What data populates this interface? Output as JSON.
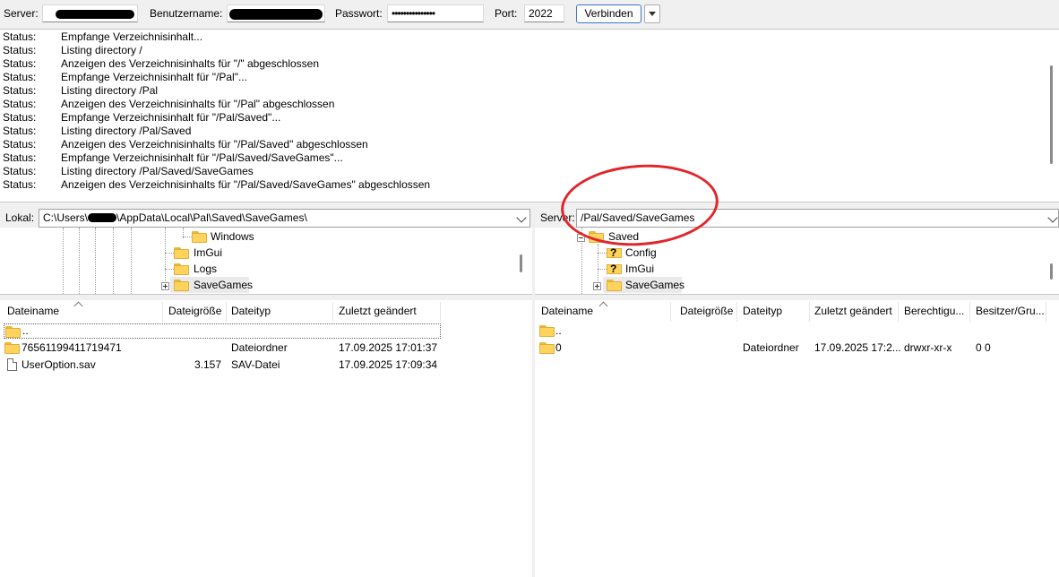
{
  "quickconnect": {
    "server_label": "Server:",
    "server_value": "",
    "username_label": "Benutzername:",
    "username_value": "",
    "password_label": "Passwort:",
    "password_value": "•••••••••••••••",
    "port_label": "Port:",
    "port_value": "2022",
    "connect_label": "Verbinden"
  },
  "log": [
    {
      "k": "Status:",
      "v": "Empfange Verzeichnisinhalt..."
    },
    {
      "k": "Status:",
      "v": "Listing directory /"
    },
    {
      "k": "Status:",
      "v": "Anzeigen des Verzeichnisinhalts für \"/\" abgeschlossen"
    },
    {
      "k": "Status:",
      "v": "Empfange Verzeichnisinhalt für \"/Pal\"..."
    },
    {
      "k": "Status:",
      "v": "Listing directory /Pal"
    },
    {
      "k": "Status:",
      "v": "Anzeigen des Verzeichnisinhalts für \"/Pal\" abgeschlossen"
    },
    {
      "k": "Status:",
      "v": "Empfange Verzeichnisinhalt für \"/Pal/Saved\"..."
    },
    {
      "k": "Status:",
      "v": "Listing directory /Pal/Saved"
    },
    {
      "k": "Status:",
      "v": "Anzeigen des Verzeichnisinhalts für \"/Pal/Saved\" abgeschlossen"
    },
    {
      "k": "Status:",
      "v": "Empfange Verzeichnisinhalt für \"/Pal/Saved/SaveGames\"..."
    },
    {
      "k": "Status:",
      "v": "Listing directory /Pal/Saved/SaveGames"
    },
    {
      "k": "Status:",
      "v": "Anzeigen des Verzeichnisinhalts für \"/Pal/Saved/SaveGames\" abgeschlossen"
    }
  ],
  "local": {
    "path_label": "Lokal:",
    "path_prefix": "C:\\Users\\",
    "path_suffix": "\\AppData\\Local\\Pal\\Saved\\SaveGames\\",
    "tree": [
      "Windows",
      "ImGui",
      "Logs",
      "SaveGames"
    ],
    "columns": [
      "Dateiname",
      "Dateigröße",
      "Dateityp",
      "Zuletzt geändert"
    ],
    "rows": [
      {
        "name": "..",
        "size": "",
        "type": "",
        "modified": ""
      },
      {
        "name": "76561199411719471",
        "size": "",
        "type": "Dateiordner",
        "modified": "17.09.2025 17:01:37"
      },
      {
        "name": "UserOption.sav",
        "size": "3.157",
        "type": "SAV-Datei",
        "modified": "17.09.2025 17:09:34"
      }
    ]
  },
  "remote": {
    "path_label": "Server:",
    "path_value": "/Pal/Saved/SaveGames",
    "tree": [
      "Saved",
      "Config",
      "ImGui",
      "SaveGames"
    ],
    "columns": [
      "Dateiname",
      "Dateigröße",
      "Dateityp",
      "Zuletzt geändert",
      "Berechtigu...",
      "Besitzer/Gru..."
    ],
    "rows": [
      {
        "name": "..",
        "size": "",
        "type": "",
        "modified": "",
        "perms": "",
        "owner": ""
      },
      {
        "name": "0",
        "size": "",
        "type": "Dateiordner",
        "modified": "17.09.2025 17:2...",
        "perms": "drwxr-xr-x",
        "owner": "0 0"
      }
    ]
  },
  "colors": {
    "annotation": "#e0262b",
    "folder": "#ffd35c",
    "accent": "#3a78c6"
  }
}
